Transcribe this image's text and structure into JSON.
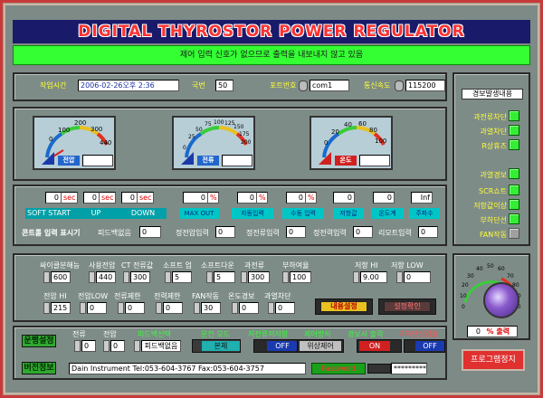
{
  "title": "DIGITAL THYROSTOR POWER REGULATOR",
  "message": "제어 입력 신호가 없으므로 출력을 내보내지 않고 있음",
  "top": {
    "time_label": "작업시간",
    "time_value": "2006-02-26오후 2:36",
    "unit_label": "국번",
    "unit_value": "50",
    "port_label": "포트번호",
    "port_value": "com1",
    "baud_label": "통신속도",
    "baud_value": "115200"
  },
  "gauges": [
    {
      "name": "전압",
      "ticks": [
        "0",
        "100",
        "200",
        "300",
        "440"
      ],
      "value": ""
    },
    {
      "name": "전류",
      "ticks": [
        "0",
        "25",
        "50",
        "75",
        "100",
        "125",
        "150",
        "175",
        "200"
      ],
      "value": ""
    },
    {
      "name": "온도",
      "ticks": [
        "0",
        "20",
        "40",
        "60",
        "80",
        "100"
      ],
      "value": ""
    }
  ],
  "readouts": {
    "soft_start": "0",
    "soft_start_unit": "sec",
    "up": "0",
    "up_unit": "sec",
    "down": "0",
    "down_unit": "sec",
    "max_out": "0",
    "max_out_unit": "%",
    "auto_in": "0",
    "auto_in_unit": "%",
    "manual_in": "0",
    "manual_in_unit": "%",
    "res_val": "0",
    "temp_val": "0",
    "freq_val": "Inf"
  },
  "status_labels": [
    "SOFT START",
    "UP",
    "DOWN",
    "MAX OUT",
    "자동입력",
    "수동 입력",
    "저항값",
    "온도계",
    "주파수"
  ],
  "control_input": {
    "label": "콘트롤 입력 표시기",
    "items": [
      {
        "label": "피드백없음",
        "value": "0"
      },
      {
        "label": "정전압입력",
        "value": "0"
      },
      {
        "label": "정전류입력",
        "value": "0"
      },
      {
        "label": "정전력입력",
        "value": "0"
      },
      {
        "label": "리모트입력",
        "value": "0"
      }
    ]
  },
  "side": {
    "header": "경보발생내용",
    "alarms": [
      {
        "label": "과전류차단",
        "on": true
      },
      {
        "label": "과열차단",
        "on": true
      },
      {
        "label": "R상휴즈",
        "on": true
      },
      {
        "label": "과열경보",
        "on": true
      },
      {
        "label": "SCR쇼트",
        "on": true
      },
      {
        "label": "저항값이상",
        "on": true
      },
      {
        "label": "부하단선",
        "on": true
      },
      {
        "label": "FAN작동",
        "on": false
      }
    ]
  },
  "settings": {
    "row1": [
      {
        "label": "싸이클분해능",
        "value": "600"
      },
      {
        "label": "사용전압",
        "value": "440"
      },
      {
        "label": "CT 전류값",
        "value": "300"
      },
      {
        "label": "소프트 업",
        "value": "5"
      },
      {
        "label": "소프트다운",
        "value": "5"
      },
      {
        "label": "과전류",
        "value": "300"
      },
      {
        "label": "부하여율",
        "value": "100"
      }
    ],
    "res_hi_label": "저항 HI",
    "res_hi_value": "9.00",
    "res_low_label": "저항 LOW",
    "res_low_value": "0",
    "row2": [
      {
        "label": "전압 HI",
        "value": "215"
      },
      {
        "label": "전압LOW",
        "value": "0"
      },
      {
        "label": "전류제한",
        "value": "0"
      },
      {
        "label": "전력제한",
        "value": "0"
      },
      {
        "label": "FAN작동",
        "value": "30"
      },
      {
        "label": "온도경보",
        "value": "0"
      },
      {
        "label": "과열차단",
        "value": "0"
      }
    ],
    "btn_set": "내용설정",
    "btn_confirm": "설정확인"
  },
  "output": {
    "value": "0",
    "unit": "% 출력",
    "ticks": [
      "0",
      "10",
      "20",
      "30",
      "40",
      "50",
      "60",
      "70",
      "80",
      "90",
      "100"
    ]
  },
  "bottom": {
    "boot_label": "운행설정",
    "cur_label": "전류",
    "cur_value": "0",
    "volt_label": "전압",
    "volt_value": "0",
    "fb_label": "피드백선택",
    "fb_value": "피드백없음",
    "mode_label": "운전 모드",
    "mode_value": "본체",
    "res_mode_label": "저전류저저항",
    "res_mode_value": "OFF",
    "ctrl_label": "제어방식",
    "ctrl_value": "위상제어",
    "alarm_out_label": "경보시 출력",
    "alarm_out_value": "ON",
    "load_label": "부하단선검출",
    "load_value": "OFF",
    "version_label": "버전정보",
    "version_text": "Dain Instrument Tel:053-604-3767 Fax:053-604-3757",
    "password_label": "Password",
    "password_value": "*********",
    "stop_button": "프로그램정지"
  },
  "colors": {
    "title_text": "#ff3030",
    "message_bg": "#33ff33",
    "label_yellow": "#ffff33",
    "led_green": "#33ee33",
    "stop_button": "#e03030"
  }
}
